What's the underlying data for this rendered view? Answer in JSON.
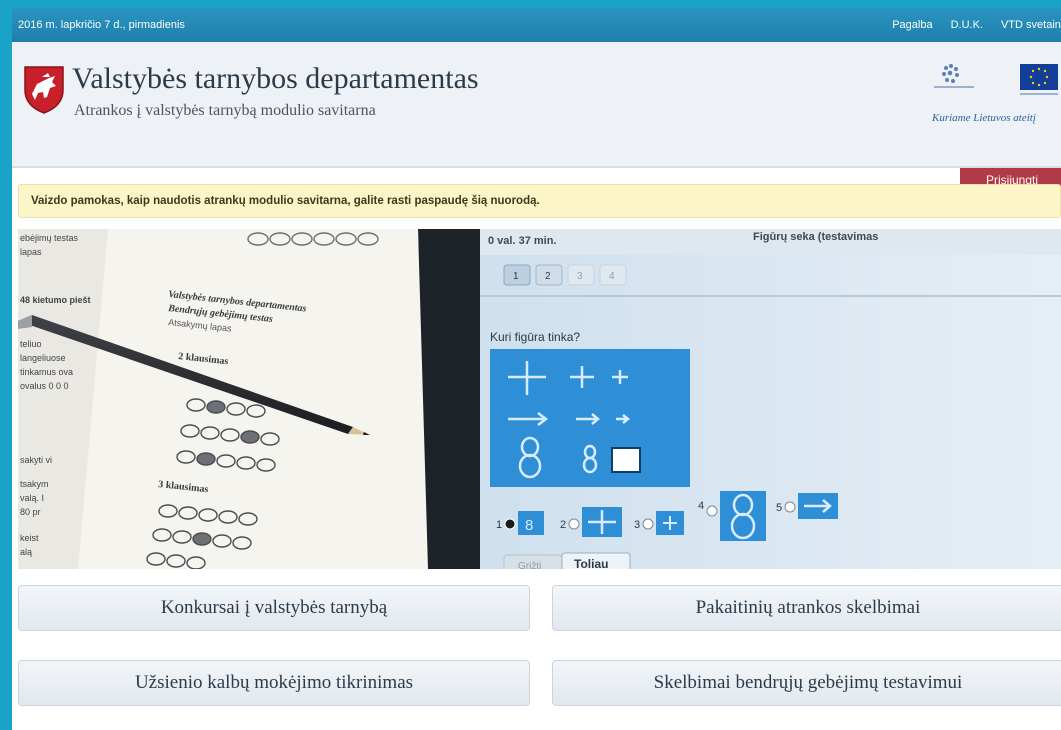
{
  "topbar": {
    "date": "2016 m. lapkričio 7 d., pirmadienis",
    "links": [
      "Pagalba",
      "D.U.K.",
      "VTD svetainė"
    ]
  },
  "header": {
    "title": "Valstybės tarnybos departamentas",
    "subtitle": "Atrankos į valstybės tarnybą modulio savitarna",
    "eu_slogan": "Kuriame Lietuvos ateitį",
    "login_label": "Prisijungti"
  },
  "notice": {
    "text": "Vaizdo pamokas, kaip naudotis atrankų modulio savitarna, galite rasti paspaudę šią nuorodą."
  },
  "banner": {
    "timer": "0 val. 37 min.",
    "test_title": "Figūrų seka (testavimas",
    "question": "Kuri figūra tinka?",
    "pages": [
      "1",
      "2",
      "3",
      "4"
    ],
    "options": [
      "1",
      "2",
      "3",
      "4",
      "5"
    ],
    "next_label": "Toliau",
    "prev_label": "Grįžti",
    "paper_title": "Valstybės tarnybos departamentas",
    "paper_sub": "Bendrųjų gebėjimų testas",
    "paper_sheet": "Atsakymų lapas",
    "paper_q2": "2 klausimas",
    "paper_q3": "3 klausimas"
  },
  "categories": [
    "Konkursai į valstybės tarnybą",
    "Pakaitinių atrankos skelbimai",
    "Užsienio kalbų mokėjimo tikrinimas",
    "Skelbimai bendrųjų gebėjimų testavimui"
  ],
  "colors": {
    "topbar": "#1f7fac",
    "header_bg": "#eef2f6",
    "login": "#b03a45",
    "notice_bg": "#fcf5c7",
    "test_panel": "#2e8fd6"
  }
}
